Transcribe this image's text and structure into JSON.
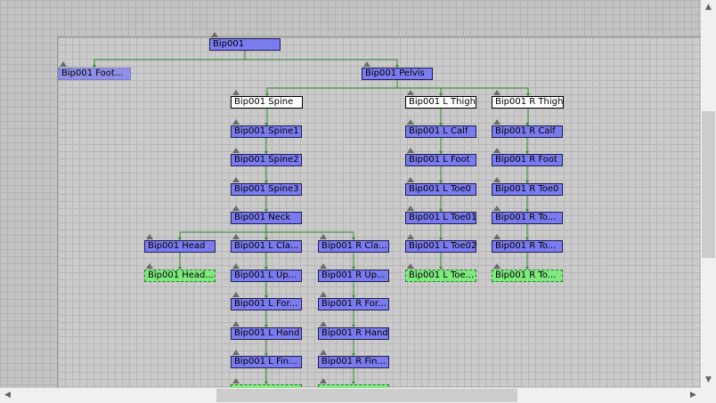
{
  "nodes": [
    {
      "id": "root",
      "label": "Bip001",
      "style": "normal"
    },
    {
      "id": "footsteps",
      "label": "Bip001 Foot...",
      "style": "float"
    },
    {
      "id": "pelvis",
      "label": "Bip001 Pelvis",
      "style": "normal"
    },
    {
      "id": "spine",
      "label": "Bip001 Spine",
      "style": "selected"
    },
    {
      "id": "lthigh",
      "label": "Bip001 L Thigh",
      "style": "selected"
    },
    {
      "id": "rthigh",
      "label": "Bip001 R Thigh",
      "style": "selected"
    },
    {
      "id": "spine1",
      "label": "Bip001 Spine1",
      "style": "normal"
    },
    {
      "id": "lcalf",
      "label": "Bip001 L Calf",
      "style": "normal"
    },
    {
      "id": "rcalf",
      "label": "Bip001 R Calf",
      "style": "normal"
    },
    {
      "id": "spine2",
      "label": "Bip001 Spine2",
      "style": "normal"
    },
    {
      "id": "lfoot",
      "label": "Bip001 L Foot",
      "style": "normal"
    },
    {
      "id": "rfoot",
      "label": "Bip001 R Foot",
      "style": "normal"
    },
    {
      "id": "spine3",
      "label": "Bip001 Spine3",
      "style": "normal"
    },
    {
      "id": "ltoe0",
      "label": "Bip001 L Toe0",
      "style": "normal"
    },
    {
      "id": "rtoe0",
      "label": "Bip001 R Toe0",
      "style": "normal"
    },
    {
      "id": "neck",
      "label": "Bip001 Neck",
      "style": "normal"
    },
    {
      "id": "ltoe01",
      "label": "Bip001 L Toe01",
      "style": "normal"
    },
    {
      "id": "rtoe01",
      "label": "Bip001 R To...",
      "style": "normal"
    },
    {
      "id": "head",
      "label": "Bip001 Head",
      "style": "normal"
    },
    {
      "id": "lclav",
      "label": "Bip001 L Cla...",
      "style": "normal"
    },
    {
      "id": "rclav",
      "label": "Bip001 R Cla...",
      "style": "normal"
    },
    {
      "id": "ltoe02",
      "label": "Bip001 L Toe02",
      "style": "normal"
    },
    {
      "id": "rtoe02",
      "label": "Bip001 R To...",
      "style": "normal"
    },
    {
      "id": "headnub",
      "label": "Bip001 Head...",
      "style": "nub"
    },
    {
      "id": "luparm",
      "label": "Bip001 L Up...",
      "style": "normal"
    },
    {
      "id": "ruparm",
      "label": "Bip001 R Up...",
      "style": "normal"
    },
    {
      "id": "ltoenub",
      "label": "Bip001 L Toe...",
      "style": "nub"
    },
    {
      "id": "rtoenub",
      "label": "Bip001 R To...",
      "style": "nub"
    },
    {
      "id": "lforearm",
      "label": "Bip001 L For...",
      "style": "normal"
    },
    {
      "id": "rforearm",
      "label": "Bip001 R For...",
      "style": "normal"
    },
    {
      "id": "lhand",
      "label": "Bip001 L Hand",
      "style": "normal"
    },
    {
      "id": "rhand",
      "label": "Bip001 R Hand",
      "style": "normal"
    },
    {
      "id": "lfinger",
      "label": "Bip001 L Fin...",
      "style": "normal"
    },
    {
      "id": "rfinger",
      "label": "Bip001 R Fin...",
      "style": "normal"
    },
    {
      "id": "lfingernub",
      "label": "",
      "style": "nub"
    },
    {
      "id": "rfingernub",
      "label": "",
      "style": "nub"
    }
  ],
  "links": [
    [
      "root",
      "footsteps"
    ],
    [
      "root",
      "pelvis"
    ],
    [
      "pelvis",
      "spine"
    ],
    [
      "pelvis",
      "lthigh"
    ],
    [
      "pelvis",
      "rthigh"
    ],
    [
      "spine",
      "spine1"
    ],
    [
      "spine1",
      "spine2"
    ],
    [
      "spine2",
      "spine3"
    ],
    [
      "spine3",
      "neck"
    ],
    [
      "neck",
      "head"
    ],
    [
      "neck",
      "lclav"
    ],
    [
      "neck",
      "rclav"
    ],
    [
      "head",
      "headnub"
    ],
    [
      "lclav",
      "luparm"
    ],
    [
      "luparm",
      "lforearm"
    ],
    [
      "lforearm",
      "lhand"
    ],
    [
      "lhand",
      "lfinger"
    ],
    [
      "lfinger",
      "lfingernub"
    ],
    [
      "rclav",
      "ruparm"
    ],
    [
      "ruparm",
      "rforearm"
    ],
    [
      "rforearm",
      "rhand"
    ],
    [
      "rhand",
      "rfinger"
    ],
    [
      "rfinger",
      "rfingernub"
    ],
    [
      "lthigh",
      "lcalf"
    ],
    [
      "lcalf",
      "lfoot"
    ],
    [
      "lfoot",
      "ltoe0"
    ],
    [
      "ltoe0",
      "ltoe01"
    ],
    [
      "ltoe01",
      "ltoe02"
    ],
    [
      "ltoe02",
      "ltoenub"
    ],
    [
      "rthigh",
      "rcalf"
    ],
    [
      "rcalf",
      "rfoot"
    ],
    [
      "rfoot",
      "rtoe0"
    ],
    [
      "rtoe0",
      "rtoe01"
    ],
    [
      "rtoe01",
      "rtoe02"
    ],
    [
      "rtoe02",
      "rtoenub"
    ]
  ],
  "colors": {
    "node_fill": "#7b7bf0",
    "selected_fill": "#ffffff",
    "nub_fill": "#7fe87f",
    "link": "#2e8a2e"
  }
}
